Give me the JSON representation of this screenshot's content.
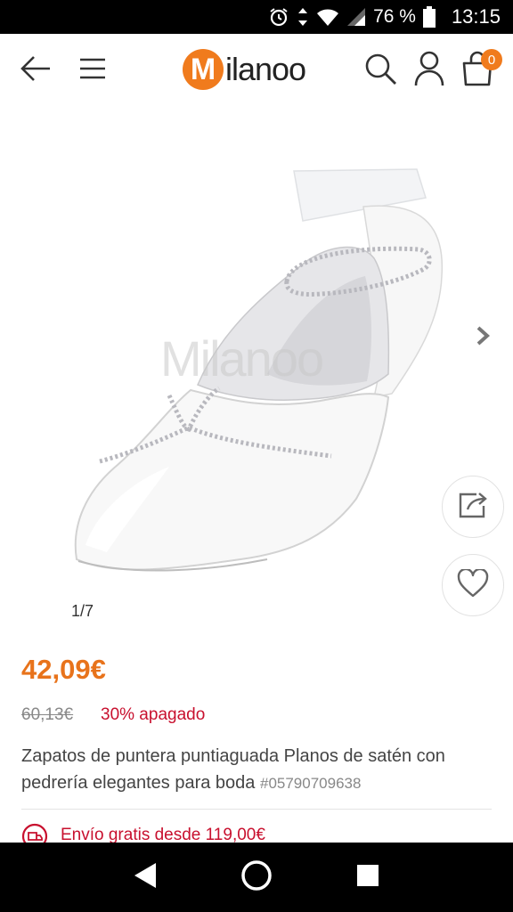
{
  "status_bar": {
    "battery_percent": "76 %",
    "time": "13:15",
    "icons": [
      "alarm-icon",
      "data-arrows-icon",
      "wifi-icon",
      "signal-icon",
      "battery-icon"
    ]
  },
  "header": {
    "logo_mark": "M",
    "logo_text": "ilanoo",
    "cart_count": "0",
    "icons": [
      "back-arrow-icon",
      "menu-icon",
      "search-icon",
      "user-icon",
      "cart-icon"
    ],
    "accent_color": "#f07b1d"
  },
  "gallery": {
    "watermark": "Milanoo",
    "counter": "1/7",
    "icons": [
      "chevron-right-icon",
      "share-icon",
      "heart-icon"
    ]
  },
  "product": {
    "price": "42,09€",
    "old_price": "60,13€",
    "discount": "30% apagado",
    "title": "Zapatos de puntera puntiaguada Planos de satén con pedrería elegantes para boda",
    "sku": "#05790709638",
    "shipping": "Envío gratis desde 119,00€",
    "price_color": "#e8731b",
    "discount_color": "#c8102e"
  },
  "nav_bar": {
    "icons": [
      "nav-back-icon",
      "nav-home-icon",
      "nav-recents-icon"
    ]
  }
}
